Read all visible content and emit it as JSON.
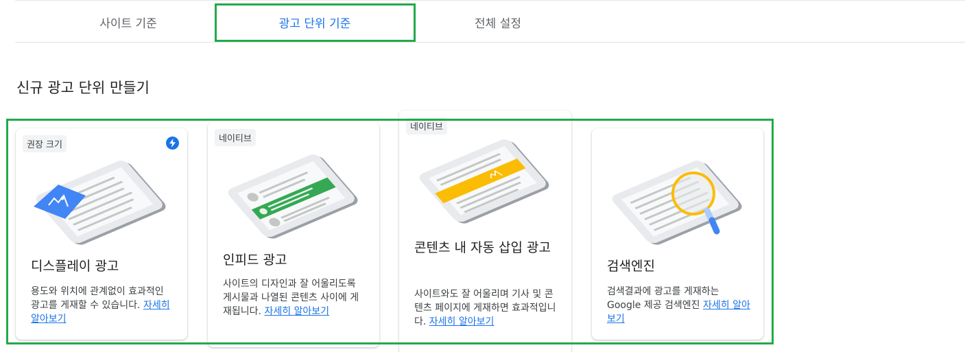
{
  "tabs": [
    {
      "label": "사이트 기준"
    },
    {
      "label": "광고 단위 기준",
      "active": true
    },
    {
      "label": "전체 설정"
    }
  ],
  "section_title": "신규 광고 단위 만들기",
  "colors": {
    "accent": "#1a73e8",
    "highlight": "#22a94a",
    "display_ad": "#4285f4",
    "infeed_ad": "#34a853",
    "inarticle_ad": "#fbbc04",
    "search_ring": "#fbbc04"
  },
  "cards": [
    {
      "badge": "권장 크기",
      "icon": "lightning-bolt-icon",
      "title": "디스플레이 광고",
      "desc": "용도와 위치에 관계없이 효과적인 광고를 게재할 수 있습니다.",
      "link": "자세히 알아보기"
    },
    {
      "badge": "네이티브",
      "title": "인피드 광고",
      "desc": "사이트의 디자인과 잘 어울리도록 게시물과 나열된 콘텐츠 사이에 게재됩니다.",
      "link": "자세히 알아보기"
    },
    {
      "badge": "네이티브",
      "title": "콘텐츠 내 자동 삽입 광고",
      "desc": "사이트와도 잘 어울리며 기사 및 콘텐츠 페이지에 게재하면 효과적입니다.",
      "link": "자세히 알아보기"
    },
    {
      "title": "검색엔진",
      "desc": "검색결과에 광고를 게재하는 Google 제공 검색엔진",
      "link": "자세히 알아보기"
    }
  ]
}
